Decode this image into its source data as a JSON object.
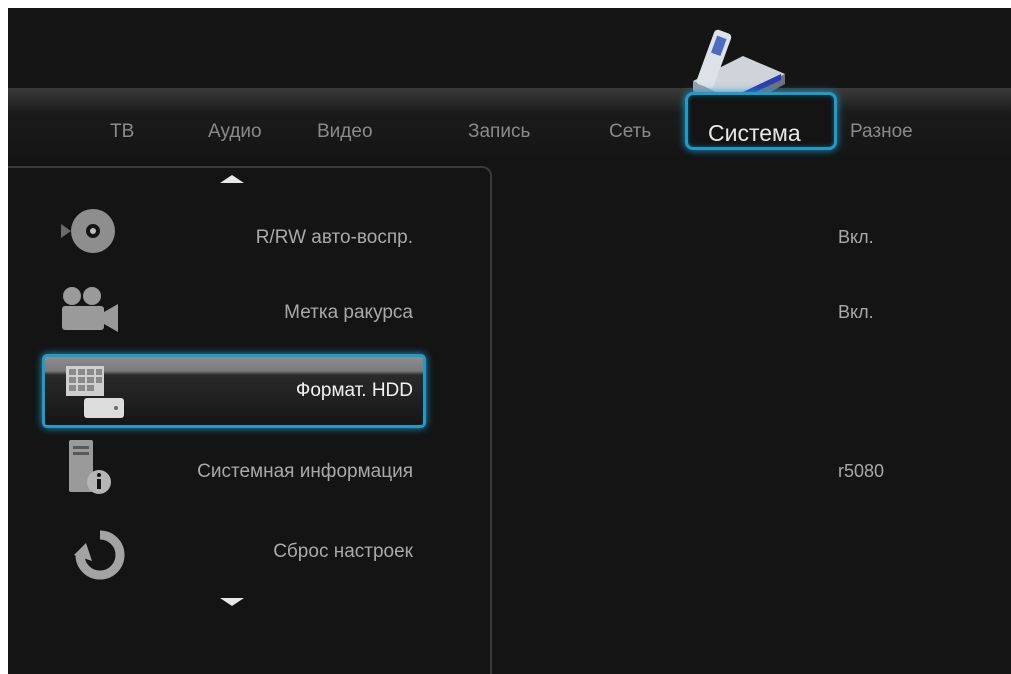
{
  "tabs": [
    {
      "label": "ТВ"
    },
    {
      "label": "Аудио"
    },
    {
      "label": "Видео"
    },
    {
      "label": "Запись"
    },
    {
      "label": "Сеть"
    },
    {
      "label": "Система"
    },
    {
      "label": "Разное"
    }
  ],
  "active_tab": "Система",
  "menu": [
    {
      "label": "R/RW авто-воспр.",
      "value": "Вкл.",
      "icon": "disc-icon"
    },
    {
      "label": "Метка ракурса",
      "value": "Вкл.",
      "icon": "camera-icon"
    },
    {
      "label": "Формат. HDD",
      "value": "",
      "icon": "hdd-format-icon",
      "selected": true
    },
    {
      "label": "Системная информация",
      "value": "r5080",
      "icon": "system-info-icon"
    },
    {
      "label": "Сброс настроек",
      "value": "",
      "icon": "reset-icon"
    }
  ],
  "colors": {
    "accent": "#1f9ac9",
    "background": "#141414",
    "text": "#a9a9a9"
  }
}
